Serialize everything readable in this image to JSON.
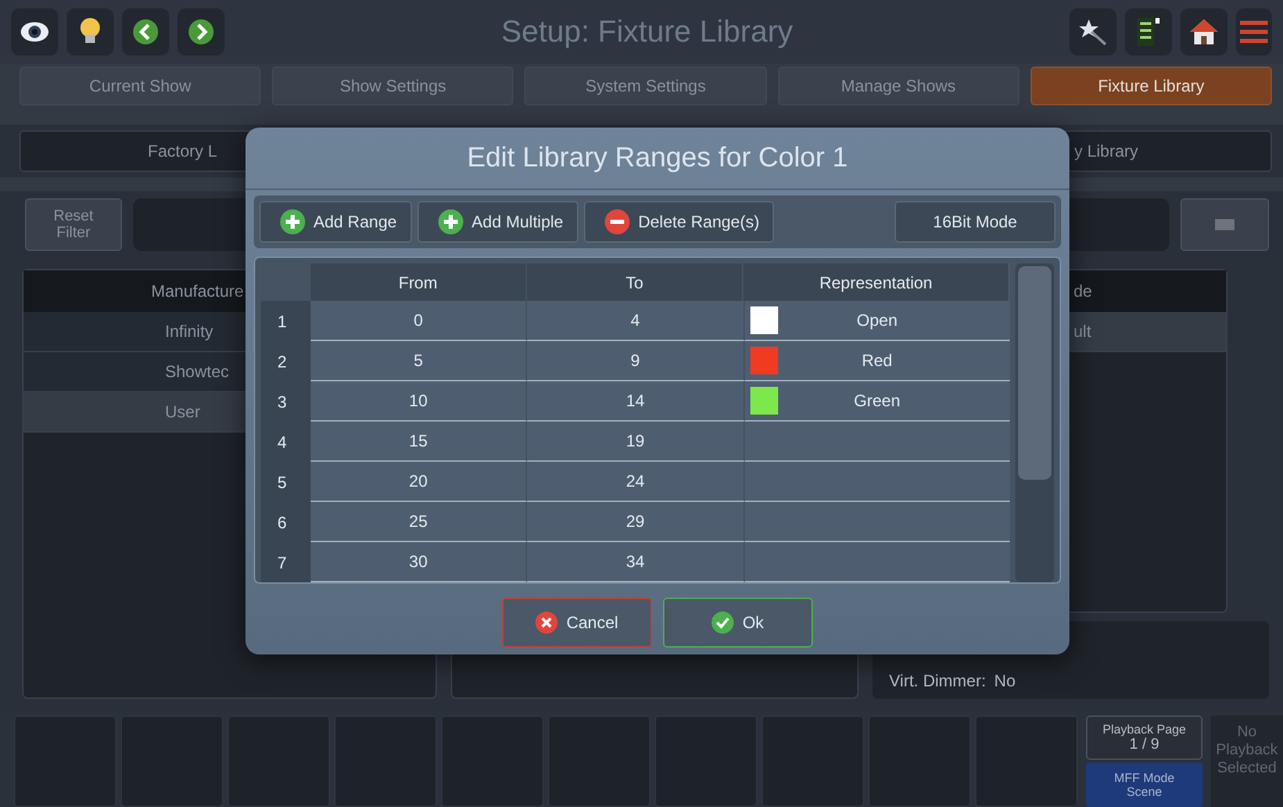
{
  "header": {
    "title": "Setup: Fixture Library"
  },
  "tabs": [
    {
      "label": "Current Show",
      "selected": false
    },
    {
      "label": "Show Settings",
      "selected": false
    },
    {
      "label": "System Settings",
      "selected": false
    },
    {
      "label": "Manage Shows",
      "selected": false
    },
    {
      "label": "Fixture Library",
      "selected": true
    }
  ],
  "library_tabs": [
    "Factory L",
    "y Library"
  ],
  "filter": {
    "reset_label": "Reset Filter"
  },
  "manufacturers": {
    "header": "Manufacture",
    "items": [
      {
        "label": "Infinity",
        "selected": false
      },
      {
        "label": "Showtec",
        "selected": false
      },
      {
        "label": "User",
        "selected": true
      }
    ]
  },
  "modes": {
    "header": "de",
    "items": [
      {
        "label": "ult",
        "selected": true
      }
    ]
  },
  "info": [
    {
      "label": "Virt. Dimmer:",
      "value": "No"
    }
  ],
  "playback": {
    "page_label": "Playback Page",
    "page": "1 / 9",
    "mff_label": "MFF Mode",
    "mff_value": "Scene",
    "status": "No Playback Selected"
  },
  "dialog": {
    "title": "Edit Library Ranges for Color 1",
    "toolbar": [
      {
        "label": "Add Range",
        "kind": "add"
      },
      {
        "label": "Add Multiple",
        "kind": "add"
      },
      {
        "label": "Delete Range(s)",
        "kind": "delete"
      }
    ],
    "mode_button": "16Bit Mode",
    "columns": [
      "From",
      "To",
      "Representation"
    ],
    "rows": [
      {
        "index": "1",
        "from": "0",
        "to": "4",
        "representation": {
          "label": "Open",
          "color": "#ffffff"
        }
      },
      {
        "index": "2",
        "from": "5",
        "to": "9",
        "representation": {
          "label": "Red",
          "color": "#f03a22"
        }
      },
      {
        "index": "3",
        "from": "10",
        "to": "14",
        "representation": {
          "label": "Green",
          "color": "#7de84a"
        }
      },
      {
        "index": "4",
        "from": "15",
        "to": "19"
      },
      {
        "index": "5",
        "from": "20",
        "to": "24"
      },
      {
        "index": "6",
        "from": "25",
        "to": "29"
      },
      {
        "index": "7",
        "from": "30",
        "to": "34"
      }
    ],
    "buttons": [
      {
        "label": "Cancel",
        "kind": "cancel"
      },
      {
        "label": "Ok",
        "kind": "ok"
      }
    ]
  }
}
